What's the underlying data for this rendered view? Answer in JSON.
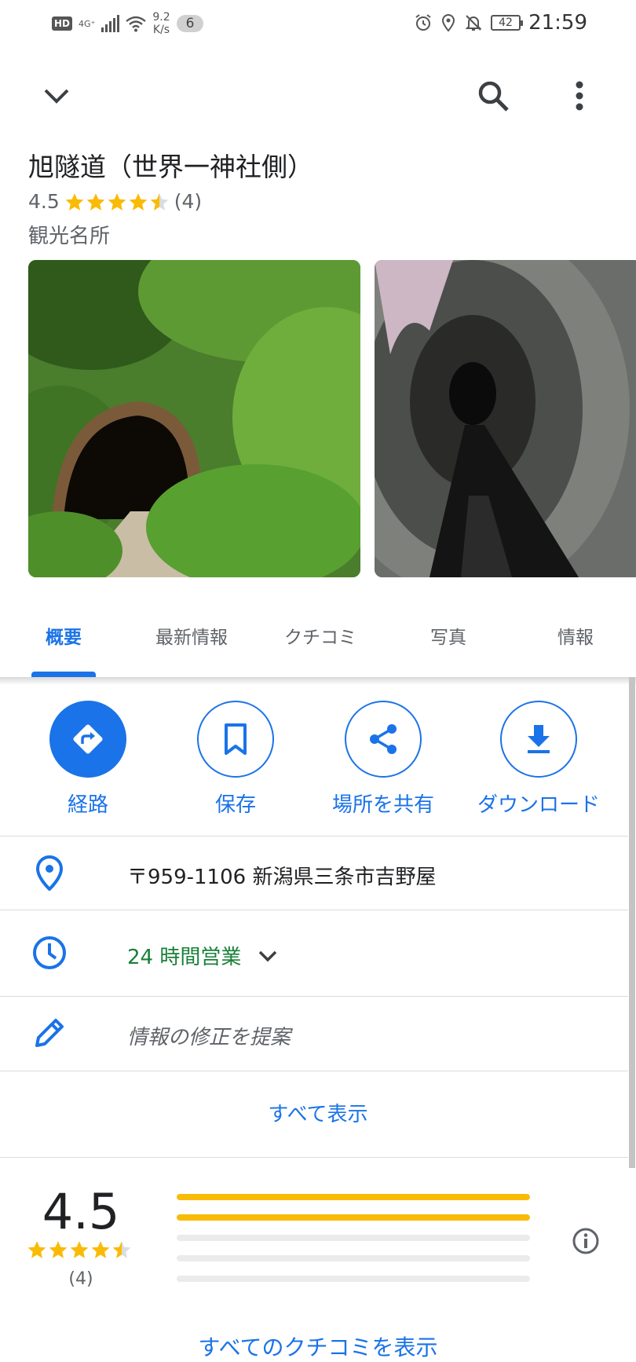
{
  "status_bar": {
    "hd": "HD",
    "network": "4G⁺",
    "speed_value": "9.2",
    "speed_unit": "K/s",
    "notification_count": "6",
    "battery": "42",
    "time": "21:59"
  },
  "place": {
    "name": "旭隧道（世界一神社側）",
    "rating": "4.5",
    "review_count": "(4)",
    "category": "観光名所"
  },
  "photos": [
    "tunnel-entrance-photo",
    "tunnel-interior-photo"
  ],
  "tabs": [
    {
      "label": "概要",
      "active": true
    },
    {
      "label": "最新情報",
      "active": false
    },
    {
      "label": "クチコミ",
      "active": false
    },
    {
      "label": "写真",
      "active": false
    },
    {
      "label": "情報",
      "active": false
    }
  ],
  "actions": [
    {
      "label": "経路",
      "icon": "directions-icon"
    },
    {
      "label": "保存",
      "icon": "bookmark-icon"
    },
    {
      "label": "場所を共有",
      "icon": "share-icon"
    },
    {
      "label": "ダウンロード",
      "icon": "download-icon"
    }
  ],
  "info": {
    "address": "〒959-1106 新潟県三条市吉野屋",
    "hours": "24 時間営業",
    "suggest_edit": "情報の修正を提案",
    "show_all": "すべて表示"
  },
  "reviews": {
    "rating": "4.5",
    "count": "(4)",
    "distribution": [
      1.0,
      1.0,
      0.0,
      0.0,
      0.0
    ],
    "all_reviews_link": "すべてのクチコミを表示"
  },
  "colors": {
    "accent": "#1a73e8",
    "star": "#f9bb05",
    "open_hours": "#188038"
  }
}
